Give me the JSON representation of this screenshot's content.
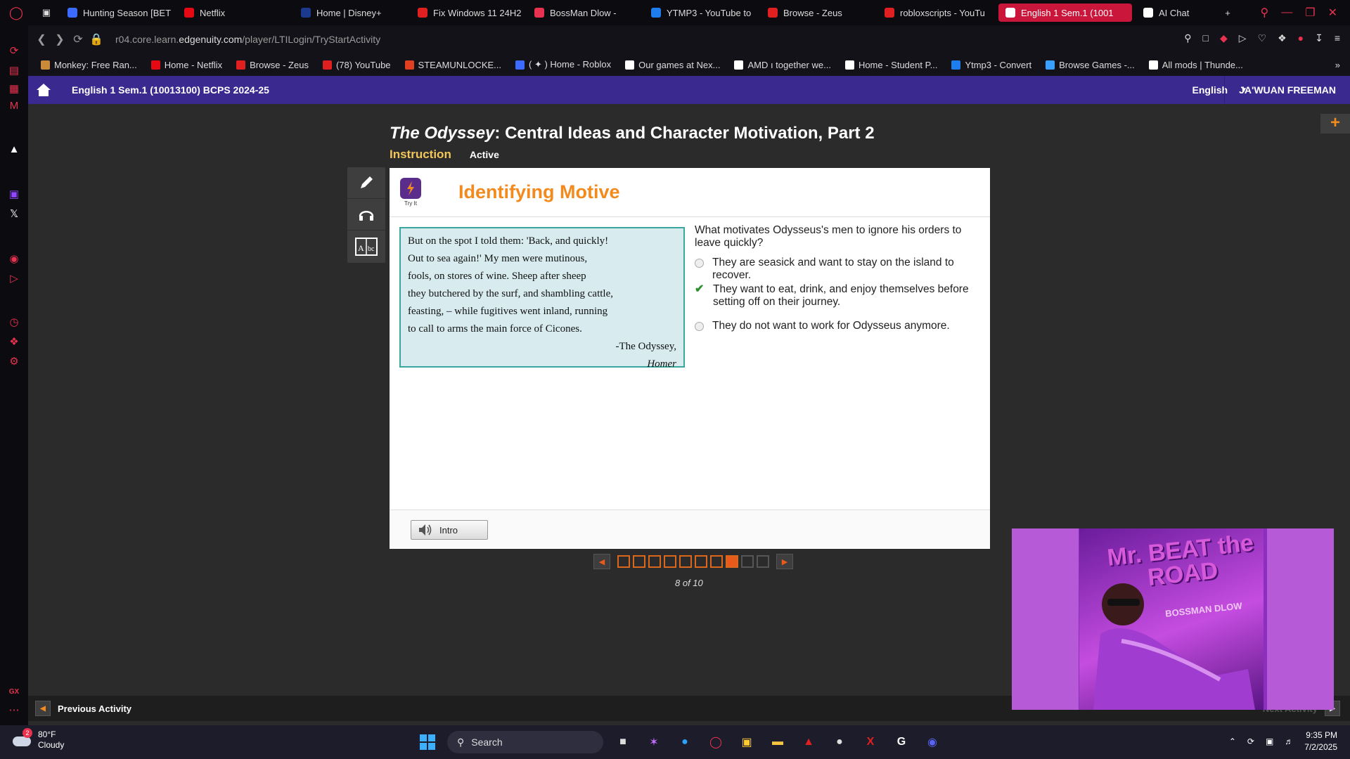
{
  "browser": {
    "tabs": [
      {
        "label": "Hunting Season [BET",
        "color": "#3d6bff"
      },
      {
        "label": "Netflix",
        "color": "#e50914"
      },
      {
        "label": "Home | Disney+",
        "color": "#1b3a8f"
      },
      {
        "label": "Fix Windows 11 24H2",
        "color": "#e02020"
      },
      {
        "label": "BossMan Dlow -",
        "color": "#e8324f"
      },
      {
        "label": "YTMP3 - YouTube to",
        "color": "#1e7ef0"
      },
      {
        "label": "Browse - Zeus",
        "color": "#e02020"
      },
      {
        "label": "robloxscripts - YouTu",
        "color": "#e02020"
      },
      {
        "label": "English 1 Sem.1 (1001",
        "color": "#ffffff"
      },
      {
        "label": "AI Chat",
        "color": "#ffffff"
      }
    ],
    "active_tab_index": 8,
    "url_prefix": "r04.core.learn.",
    "url_domain": "edgenuity.com",
    "url_path": "/player/LTILogin/TryStartActivity",
    "bookmarks": [
      {
        "label": "Monkey: Free Ran...",
        "color": "#c98a3a"
      },
      {
        "label": "Home - Netflix",
        "color": "#e50914"
      },
      {
        "label": "Browse - Zeus",
        "color": "#e02020"
      },
      {
        "label": "(78) YouTube",
        "color": "#e02020"
      },
      {
        "label": "STEAMUNLOCKE...",
        "color": "#e04020"
      },
      {
        "label": "( ✦ ) Home - Roblox",
        "color": "#3d6bff"
      },
      {
        "label": "Our games at Nex...",
        "color": "#ffffff"
      },
      {
        "label": "AMD ı together we...",
        "color": "#ffffff"
      },
      {
        "label": "Home - Student P...",
        "color": "#ffffff"
      },
      {
        "label": "Ytmp3 - Convert",
        "color": "#1e7ef0"
      },
      {
        "label": "Browse Games -...",
        "color": "#3aa0ff"
      },
      {
        "label": "All mods | Thunde...",
        "color": "#ffffff"
      }
    ]
  },
  "header": {
    "course_title": "English 1 Sem.1 (10013100) BCPS 2024-25",
    "language": "English",
    "user_name": "JA'WUAN FREEMAN"
  },
  "lesson": {
    "title_italic": "The Odyssey",
    "title_rest": ": Central Ideas and Character Motivation, Part 2",
    "section": "Instruction",
    "status": "Active"
  },
  "activity": {
    "badge_label": "Try It",
    "title": "Identifying Motive",
    "passage_lines": [
      "But on the spot I told them: 'Back, and quickly!",
      "Out to sea again!' My men were mutinous,",
      "fools, on stores of wine. Sheep after sheep",
      "they butchered by the surf, and shambling cattle,",
      "feasting, – while fugitives went inland, running",
      "to call to arms the main force of Cicones."
    ],
    "attribution_1": "-The Odyssey,",
    "attribution_2": "Homer",
    "question": "What motivates Odysseus's men to ignore his orders to leave quickly?",
    "options": [
      {
        "text": "They are seasick and want to stay on the island to recover.",
        "selected": false
      },
      {
        "text": "They want to eat, drink, and enjoy themselves before setting off on their journey.",
        "selected": true
      },
      {
        "text": "They do not want to work for Odysseus anymore.",
        "selected": false
      }
    ],
    "intro_button": "Intro"
  },
  "pager": {
    "current": 8,
    "total": 10,
    "label": "8 of 10"
  },
  "footer": {
    "previous_activity": "Previous Activity",
    "next_activity": "Next Activity"
  },
  "video": {
    "album_title_1": "Mr. BEAT the",
    "album_title_2": "ROAD",
    "artist": "BOSSMAN DLOW"
  },
  "taskbar": {
    "weather_temp": "80°F",
    "weather_desc": "Cloudy",
    "weather_badge": "2",
    "search_placeholder": "Search",
    "time": "9:35 PM",
    "date": "7/2/2025"
  }
}
